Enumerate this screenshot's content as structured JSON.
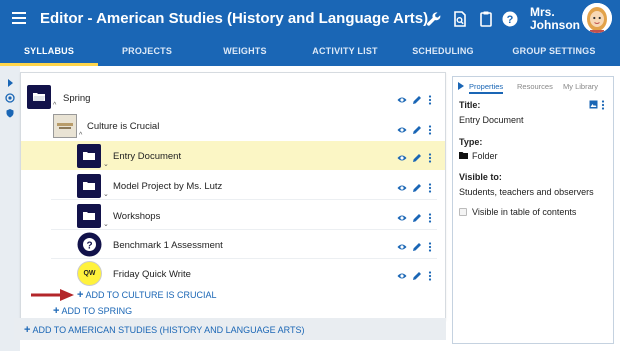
{
  "header": {
    "title": "Editor - American Studies (History and Language Arts)",
    "user_name": "Mrs.\nJohnson",
    "icons": [
      "wrench-icon",
      "search-doc-icon",
      "clipboard-icon",
      "help-icon"
    ]
  },
  "tabs": [
    {
      "label": "SYLLABUS",
      "active": true
    },
    {
      "label": "PROJECTS",
      "active": false
    },
    {
      "label": "WEIGHTS",
      "active": false
    },
    {
      "label": "ACTIVITY LIST",
      "active": false
    },
    {
      "label": "SCHEDULING",
      "active": false
    },
    {
      "label": "GROUP SETTINGS",
      "active": false
    }
  ],
  "tree": {
    "items": [
      {
        "label": "Spring",
        "icon": "folder-open-icon"
      },
      {
        "label": "Culture is Crucial",
        "icon": "thumbnail-icon"
      },
      {
        "label": "Entry Document",
        "icon": "folder-icon",
        "highlighted": true
      },
      {
        "label": "Model Project by Ms. Lutz",
        "icon": "folder-icon"
      },
      {
        "label": "Workshops",
        "icon": "folder-icon"
      },
      {
        "label": "Benchmark 1 Assessment",
        "icon": "question-icon"
      },
      {
        "label": "Friday Quick Write",
        "icon": "qw-icon",
        "badge": "QW"
      }
    ],
    "add_culture": "ADD TO CULTURE IS CRUCIAL",
    "add_spring": "ADD TO SPRING",
    "add_course": "ADD TO AMERICAN STUDIES (HISTORY AND LANGUAGE ARTS)"
  },
  "properties": {
    "tabs": [
      "Properties",
      "Resources",
      "My Library"
    ],
    "title_label": "Title:",
    "title_value": "Entry Document",
    "type_label": "Type:",
    "type_value": "Folder",
    "visible_label": "Visible to:",
    "visible_value": "Students, teachers and observers",
    "toc_label": "Visible in table of contents",
    "toc_checked": false
  },
  "colors": {
    "primary": "#1a66b5",
    "tab_indicator": "#ffd54a",
    "folder": "#12124a",
    "highlight": "#fbf6c5",
    "arrow": "#b3262a"
  }
}
